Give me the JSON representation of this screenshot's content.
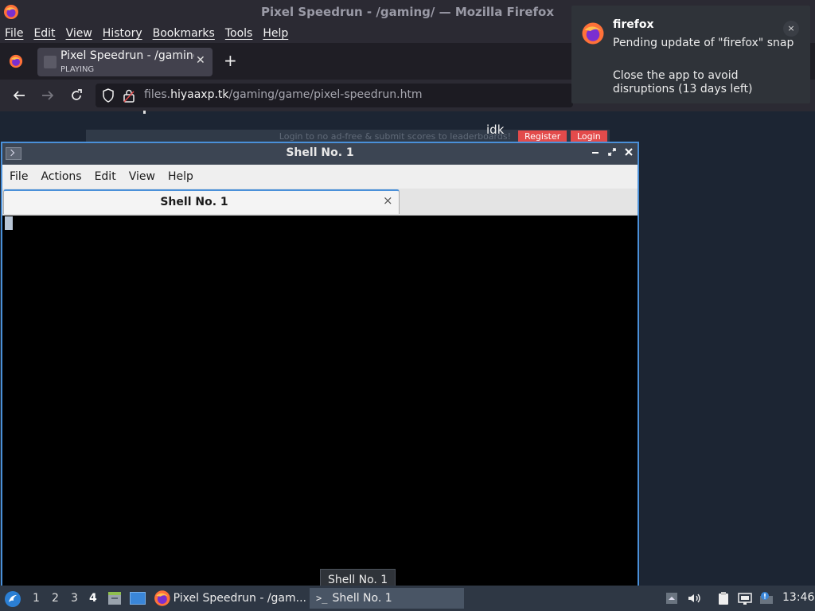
{
  "firefox": {
    "window_title": "Pixel Speedrun - /gaming/ — Mozilla Firefox",
    "menu": [
      "File",
      "Edit",
      "View",
      "History",
      "Bookmarks",
      "Tools",
      "Help"
    ],
    "tab": {
      "title": "Pixel Speedrun - /gaming",
      "subtitle": "PLAYING"
    },
    "url": {
      "prefix": "files.",
      "host": "hiyaaxp.tk",
      "path": "/gaming/game/pixel-speedrun.htm"
    }
  },
  "page": {
    "banner_text": "Login to no ad-free & submit scores to leaderboards!",
    "register_label": "Register",
    "login_label": "Login",
    "username": "idk"
  },
  "notification": {
    "app": "firefox",
    "line1": "Pending update of \"firefox\" snap",
    "line2": "Close the app to avoid disruptions (13 days left)",
    "close": "×"
  },
  "terminal": {
    "title": "Shell No. 1",
    "menu": [
      "File",
      "Actions",
      "Edit",
      "View",
      "Help"
    ],
    "tab_title": "Shell No. 1"
  },
  "tooltip": "Shell No. 1",
  "taskbar": {
    "workspaces": [
      "1",
      "2",
      "3",
      "4"
    ],
    "active_workspace": "4",
    "tasks": [
      {
        "label": "Pixel Speedrun - /gam..."
      },
      {
        "label": "Shell No. 1"
      }
    ],
    "clock": "13:46"
  },
  "colors": {
    "accent": "#4a90d9",
    "page_button": "#e34b4b",
    "taskbar": "#2e3744"
  }
}
